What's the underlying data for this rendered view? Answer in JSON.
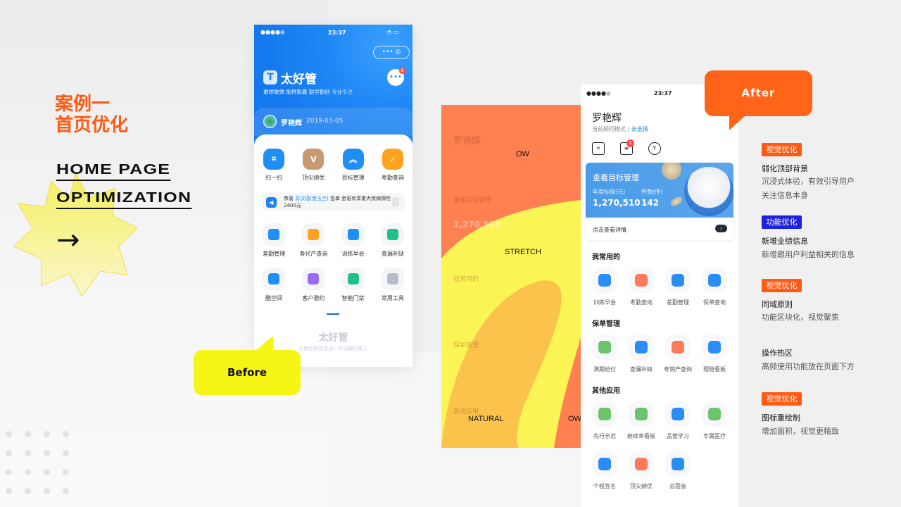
{
  "left": {
    "title_line1": "案例一",
    "title_line2": "首页优化",
    "en_line1": "HOME PAGE",
    "en_line2": "OPTIMIZATION",
    "arrow": "→"
  },
  "colors": {
    "accent_orange": "#ff5a14",
    "after_orange": "#ff6419",
    "before_yellow": "#f6f516",
    "func_blue": "#1c22e0",
    "app_blue": "#1a84f2"
  },
  "before": {
    "status_time": "23:37",
    "capsule": "•••  ◎",
    "app_name": "太好管",
    "logo": "T",
    "slogan": "敢想敢做 能拼能赢 勤学勤创 专业专注",
    "msg_badge": "8",
    "user_name": "罗艳辉",
    "user_date": "2019-03-05",
    "top_items": [
      {
        "label": "扫一扫",
        "icon": "scan-icon",
        "color": "#1f8ff5"
      },
      {
        "label": "顶尖绩优",
        "icon": "star-icon",
        "color": "#c79a74"
      },
      {
        "label": "目标管理",
        "icon": "target-icon",
        "color": "#1f8ff5"
      },
      {
        "label": "考勤查询",
        "icon": "calendar-icon",
        "color": "#ffa21f"
      }
    ],
    "notice": {
      "prefix": "恭喜",
      "name": "苏汉语(金玉兰)",
      "text": "签单 金诺优享重大疾病保险 2400元"
    },
    "items": [
      {
        "label": "差勤管理",
        "color": "#1f8ff5"
      },
      {
        "label": "寿代产查询",
        "color": "#ffa21f"
      },
      {
        "label": "训练早会",
        "color": "#1f8ff5"
      },
      {
        "label": "查漏补缺",
        "color": "#20c08a"
      },
      {
        "label": "酷空间",
        "color": "#1f8ff5"
      },
      {
        "label": "客户邀约",
        "color": "#9b6bf0"
      },
      {
        "label": "智能门禁",
        "color": "#20c08a"
      },
      {
        "label": "常用工具",
        "color": "#b8bcc6"
      }
    ],
    "footer_title": "太好管",
    "footer_slogan": "· 让团队经营变成一件温暖的事儿 ·"
  },
  "bubbles": {
    "before": "Before",
    "after": "After"
  },
  "heatmap": {
    "labels": [
      "OW",
      "STRETCH",
      "NATURAL",
      "OW"
    ]
  },
  "after": {
    "status_time": "23:37",
    "user_name": "罗艳辉",
    "mode": "当前顾问模式",
    "select": "去选择",
    "doc_badge": "1",
    "card": {
      "title": "查看目标管理",
      "label1": "年度标保(元)",
      "value1": "1,270,510",
      "label2": "件数(件)",
      "value2": "142",
      "detail": "点击查看详情"
    },
    "sections": [
      {
        "title": "我常用的",
        "items": [
          {
            "label": "训练早会",
            "color": "#2a8cf5"
          },
          {
            "label": "考勤查询",
            "color": "#ff7a5a"
          },
          {
            "label": "差勤管理",
            "color": "#2a8cf5"
          },
          {
            "label": "保单查询",
            "color": "#2a8cf5"
          }
        ]
      },
      {
        "title": "保单管理",
        "items": [
          {
            "label": "满期给付",
            "color": "#6cc46c"
          },
          {
            "label": "查漏补缺",
            "color": "#2a8cf5"
          },
          {
            "label": "寿销产查询",
            "color": "#ff7a5a"
          },
          {
            "label": "理赔看板",
            "color": "#2a8cf5"
          }
        ]
      },
      {
        "title": "其他应用",
        "items": [
          {
            "label": "先行示范",
            "color": "#6cc46c"
          },
          {
            "label": "继续率看板",
            "color": "#6cc46c"
          },
          {
            "label": "品管学习",
            "color": "#2a8cf5"
          },
          {
            "label": "专属医疗",
            "color": "#6cc46c"
          },
          {
            "label": "个税签名",
            "color": "#2a8cf5"
          },
          {
            "label": "顶尖绩优",
            "color": "#ff7a5a"
          },
          {
            "label": "总面会",
            "color": "#2a8cf5"
          }
        ]
      }
    ]
  },
  "notes": [
    {
      "tag": "视觉优化",
      "tag_color": "#ff5a14",
      "title": "弱化顶部背景",
      "desc1": "沉浸式体验，有效引导用户",
      "desc2": "关注信息本身"
    },
    {
      "tag": "功能优化",
      "tag_color": "#1c22e0",
      "title": "新增业绩信息",
      "desc1": "新增跟用户利益相关的信息"
    },
    {
      "tag": "视觉优化",
      "tag_color": "#ff5a14",
      "title": "同域原则",
      "desc1": "功能区块化，视觉聚焦"
    },
    {
      "title": "操作热区",
      "desc1": "高频使用功能放在页面下方"
    },
    {
      "tag": "视觉优化",
      "tag_color": "#ff5a14",
      "title": "图标重绘制",
      "desc1": "增加面积，视觉更精致"
    }
  ]
}
